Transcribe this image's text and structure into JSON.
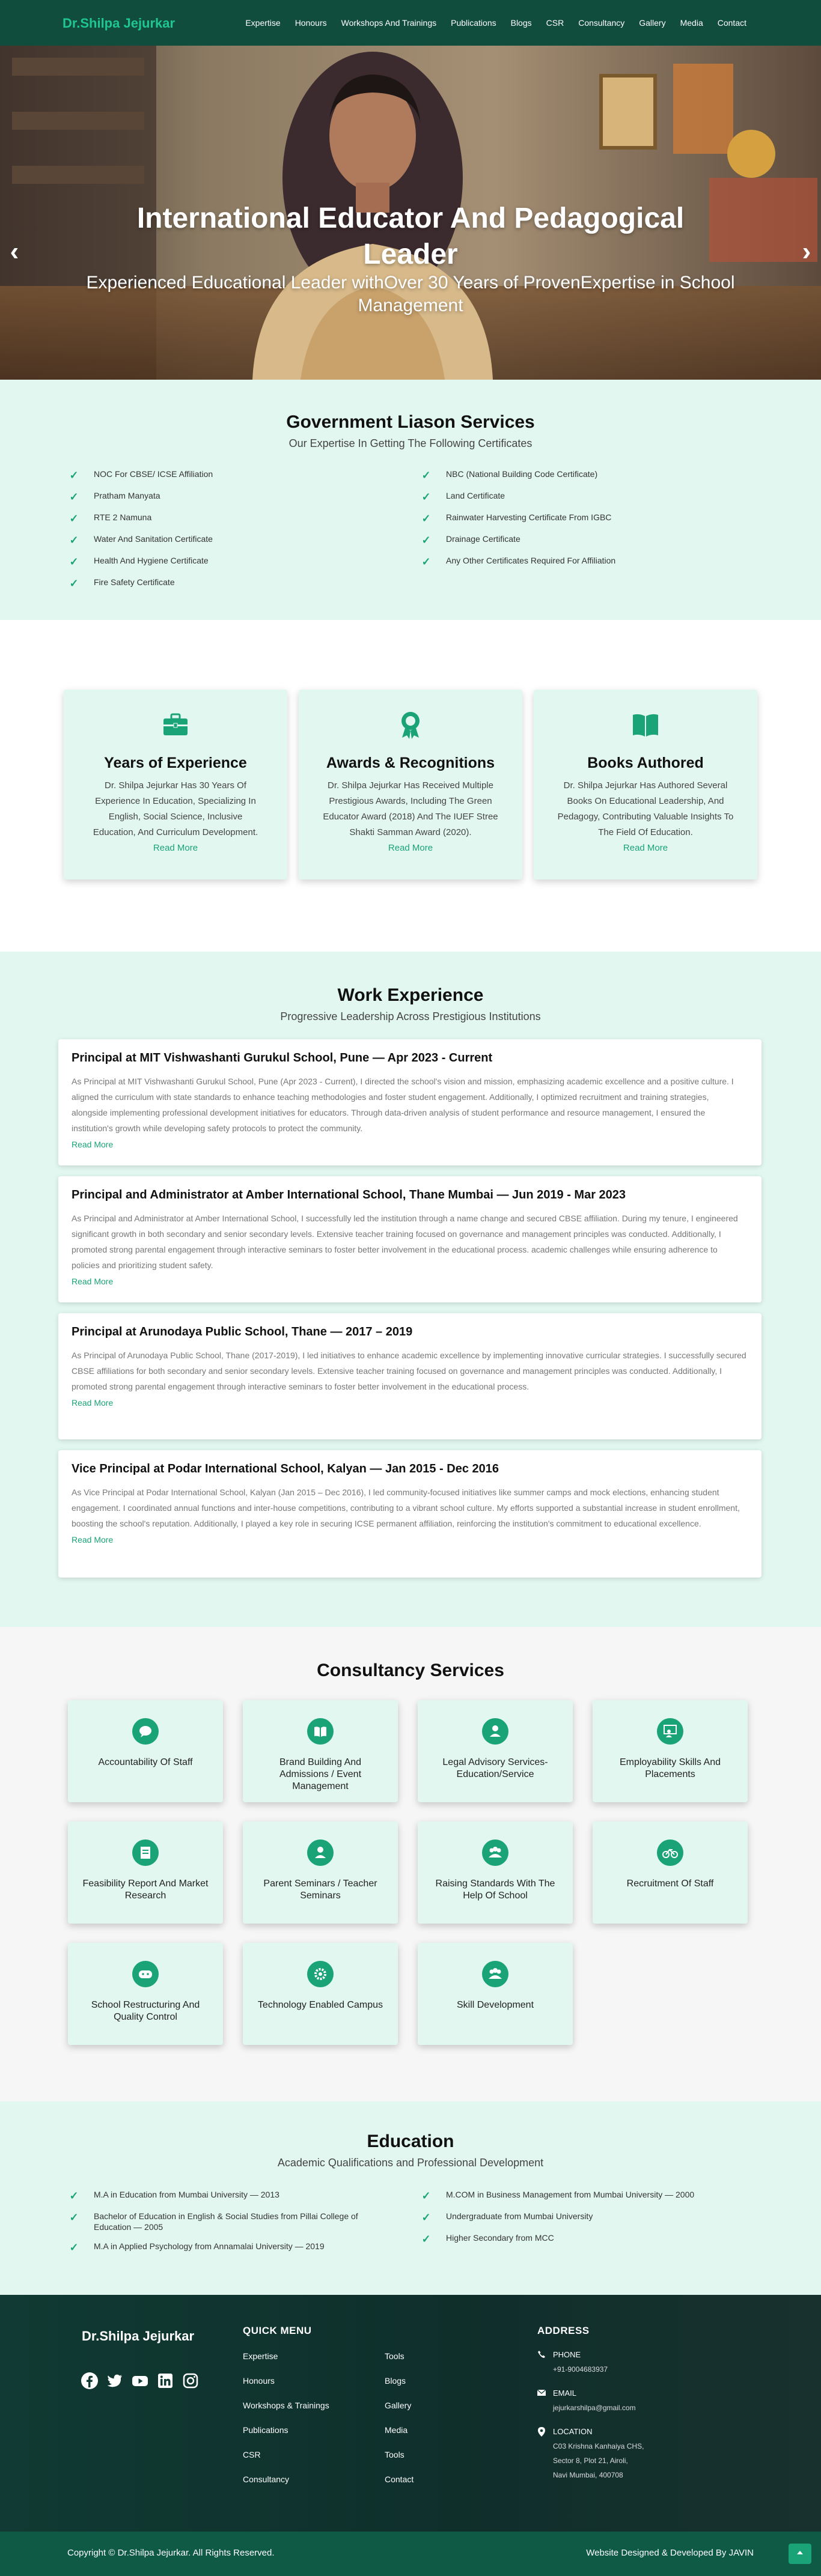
{
  "nav": {
    "brand": "Dr.Shilpa Jejurkar",
    "items": [
      "Expertise",
      "Honours",
      "Workshops And Trainings",
      "Publications",
      "Blogs",
      "CSR",
      "Consultancy",
      "Gallery",
      "Media",
      "Contact"
    ]
  },
  "hero": {
    "title": "International Educator And Pedagogical Leader",
    "subtitle": "Experienced Educational Leader withOver 30 Years of ProvenExpertise in School Management",
    "prev": "‹",
    "next": "›"
  },
  "gov": {
    "title": "Government Liason Services",
    "subtitle": "Our Expertise In Getting The Following Certificates",
    "left": [
      "NOC For CBSE/ ICSE Affiliation",
      "Pratham Manyata",
      "RTE 2 Namuna",
      "Water And Sanitation Certificate",
      "Health And Hygiene Certificate",
      "Fire Safety Certificate"
    ],
    "right": [
      "NBC (National Building Code Certificate)",
      "Land Certificate",
      "Rainwater Harvesting Certificate From IGBC",
      "Drainage Certificate",
      "Any Other Certificates Required For Affiliation"
    ]
  },
  "stats": [
    {
      "icon": "briefcase-icon",
      "title": "Years of Experience",
      "desc": "Dr. Shilpa Jejurkar Has 30 Years Of Experience In Education, Specializing In English, Social Science, Inclusive Education, And Curriculum Development.",
      "link": "Read More"
    },
    {
      "icon": "award-icon",
      "title": "Awards & Recognitions",
      "desc": "Dr. Shilpa Jejurkar Has Received Multiple Prestigious Awards, Including The Green Educator Award (2018) And The IUEF Stree Shakti Samman Award (2020).",
      "link": "Read More"
    },
    {
      "icon": "book-icon",
      "title": "Books Authored",
      "desc": "Dr. Shilpa Jejurkar Has Authored Several Books On Educational Leadership, And Pedagogy, Contributing Valuable Insights To The Field Of Education.",
      "link": "Read More"
    }
  ],
  "work": {
    "title": "Work Experience",
    "subtitle": "Progressive Leadership Across Prestigious Institutions",
    "jobs": [
      {
        "title": "Principal at MIT Vishwashanti Gurukul School, Pune — Apr 2023 - Current",
        "desc": "As Principal at MIT Vishwashanti Gurukul School, Pune (Apr 2023 - Current), I directed the school's vision and mission, emphasizing academic excellence and a positive culture. I aligned the curriculum with state standards to enhance teaching methodologies and foster student engagement. Additionally, I optimized recruitment and training strategies, alongside implementing professional development initiatives for educators. Through data-driven analysis of student performance and resource management, I ensured the institution's growth while developing safety protocols to protect the community.",
        "link": "Read More"
      },
      {
        "title": "Principal and Administrator at Amber International School, Thane Mumbai — Jun 2019 - Mar 2023",
        "desc": "As Principal and Administrator at Amber International School, I successfully led the institution through a name change and secured CBSE affiliation. During my tenure, I engineered significant growth in both secondary and senior secondary levels. Extensive teacher training focused on governance and management principles was conducted. Additionally, I promoted strong parental engagement through interactive seminars to foster better involvement in the educational process. academic challenges while ensuring adherence to policies and prioritizing student safety.",
        "link": "Read More"
      },
      {
        "title": "Principal at Arunodaya Public School, Thane — 2017 – 2019",
        "desc": "As Principal of Arunodaya Public School, Thane (2017-2019), I led initiatives to enhance academic excellence by implementing innovative curricular strategies. I successfully secured CBSE affiliations for both secondary and senior secondary levels. Extensive teacher training focused on governance and management principles was conducted. Additionally, I promoted strong parental engagement through interactive seminars to foster better involvement in the educational process.",
        "link": "Read More"
      },
      {
        "title": "Vice Principal at Podar International School, Kalyan — Jan 2015 - Dec 2016",
        "desc": "As Vice Principal at Podar International School, Kalyan (Jan 2015 – Dec 2016), I led community-focused initiatives like summer camps and mock elections, enhancing student engagement. I coordinated annual functions and inter-house competitions, contributing to a vibrant school culture. My efforts supported a substantial increase in student enrollment, boosting the school's reputation. Additionally, I played a key role in securing ICSE permanent affiliation, reinforcing the institution's commitment to educational excellence.",
        "link": "Read More"
      }
    ]
  },
  "consult": {
    "title": "Consultancy Services",
    "items": [
      {
        "icon": "chat-icon",
        "label": "Accountability Of Staff"
      },
      {
        "icon": "book-icon",
        "label": "Brand Building And Admissions / Event Management"
      },
      {
        "icon": "advisory-icon",
        "label": "Legal Advisory Services-Education/Service"
      },
      {
        "icon": "teacher-icon",
        "label": "Employability Skills And Placements"
      },
      {
        "icon": "report-icon",
        "label": "Feasibility Report And Market Research"
      },
      {
        "icon": "seminar-icon",
        "label": "Parent Seminars / Teacher Seminars"
      },
      {
        "icon": "group-icon",
        "label": "Raising Standards With The Help Of School"
      },
      {
        "icon": "bicycle-icon",
        "label": "Recruitment Of Staff"
      },
      {
        "icon": "controller-icon",
        "label": "School Restructuring And Quality Control"
      },
      {
        "icon": "gear-icon",
        "label": "Technology Enabled Campus"
      },
      {
        "icon": "group-icon",
        "label": "Skill Development"
      }
    ]
  },
  "edu": {
    "title": "Education",
    "subtitle": "Academic Qualifications and Professional Development",
    "left": [
      "M.A in Education from Mumbai University — 2013",
      "Bachelor of Education in English & Social Studies from Pillai College of Education — 2005",
      "M.A in Applied Psychology from Annamalai University — 2019"
    ],
    "right": [
      "M.COM in Business Management from Mumbai University — 2000",
      "Undergraduate from Mumbai University",
      "Higher Secondary from MCC"
    ]
  },
  "footer": {
    "brand": "Dr.Shilpa Jejurkar",
    "quick_title": "QUICK MENU",
    "col1": [
      "Expertise",
      "Honours",
      "Workshops & Trainings",
      "Publications",
      "CSR",
      "Consultancy"
    ],
    "col2": [
      "Tools",
      "Blogs",
      "Gallery",
      "Media",
      "Tools",
      "Contact"
    ],
    "address_title": "ADDRESS",
    "phone_label": "PHONE",
    "phone": "+91-9004683937",
    "email_label": "EMAIL",
    "email": "jejurkarshilpa@gmail.com",
    "location_label": "LOCATION",
    "location": [
      "C03 Krishna Kanhaiya CHS,",
      "Sector 8, Plot 21, Airoli,",
      "Navi Mumbai, 400708"
    ],
    "social": [
      "facebook-icon",
      "twitter-icon",
      "youtube-icon",
      "linkedin-icon",
      "instagram-icon"
    ],
    "copyright": "Copyright © Dr.Shilpa Jejurkar. All Rights Reserved.",
    "credit": "Website Designed & Developed By JAVIN"
  },
  "colors": {
    "brand": "#20c690",
    "accent": "#1aa377",
    "nav": "#114d3d",
    "mint": "#e3f7f1"
  }
}
